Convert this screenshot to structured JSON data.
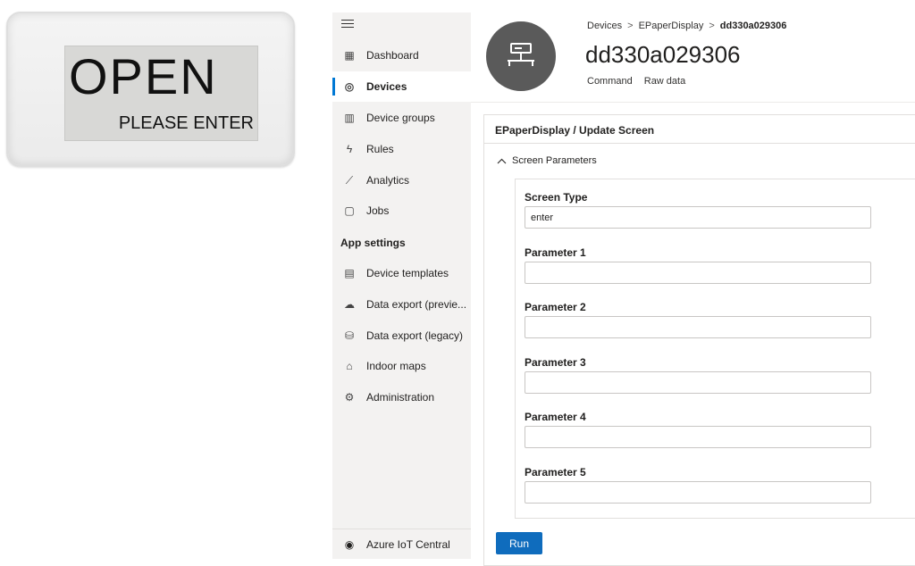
{
  "device_photo": {
    "line1": "OPEN",
    "line2": "PLEASE ENTER"
  },
  "sidebar": {
    "items": [
      {
        "label": "Dashboard",
        "icon": "dashboard-icon",
        "glyph": "▦"
      },
      {
        "label": "Devices",
        "icon": "devices-icon",
        "glyph": "◎",
        "active": true
      },
      {
        "label": "Device groups",
        "icon": "device-groups-icon",
        "glyph": "▥"
      },
      {
        "label": "Rules",
        "icon": "rules-icon",
        "glyph": "ϟ"
      },
      {
        "label": "Analytics",
        "icon": "analytics-icon",
        "glyph": "⟋"
      },
      {
        "label": "Jobs",
        "icon": "jobs-icon",
        "glyph": "▢"
      }
    ],
    "app_settings_heading": "App settings",
    "settings_items": [
      {
        "label": "Device templates",
        "icon": "device-templates-icon",
        "glyph": "▤"
      },
      {
        "label": "Data export (previe...",
        "icon": "data-export-preview-icon",
        "glyph": "☁"
      },
      {
        "label": "Data export (legacy)",
        "icon": "data-export-legacy-icon",
        "glyph": "⛁"
      },
      {
        "label": "Indoor maps",
        "icon": "indoor-maps-icon",
        "glyph": "⌂"
      },
      {
        "label": "Administration",
        "icon": "administration-icon",
        "glyph": "⚙"
      }
    ],
    "footer": {
      "label": "Azure IoT Central",
      "icon": "azure-iot-central-icon",
      "glyph": "◉"
    }
  },
  "header": {
    "breadcrumb": [
      "Devices",
      "EPaperDisplay",
      "dd330a029306"
    ],
    "breadcrumb_separator": ">",
    "title": "dd330a029306",
    "tabs": [
      "Command",
      "Raw data"
    ]
  },
  "command": {
    "title": "EPaperDisplay / Update Screen",
    "section_label": "Screen Parameters",
    "fields": [
      {
        "label": "Screen Type",
        "value": "enter"
      },
      {
        "label": "Parameter 1",
        "value": ""
      },
      {
        "label": "Parameter 2",
        "value": ""
      },
      {
        "label": "Parameter 3",
        "value": ""
      },
      {
        "label": "Parameter 4",
        "value": ""
      },
      {
        "label": "Parameter 5",
        "value": ""
      }
    ],
    "run_label": "Run"
  },
  "colors": {
    "accent": "#0078d4",
    "button": "#0f6cbd",
    "sidebar_bg": "#f3f2f1",
    "avatar_bg": "#5a5a5a"
  }
}
